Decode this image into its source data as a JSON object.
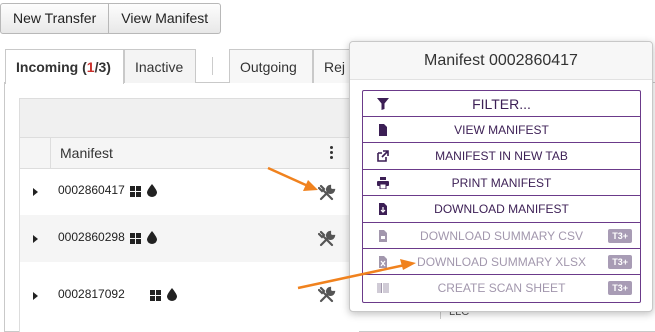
{
  "toolbar": {
    "new_transfer": "New Transfer",
    "view_manifest": "View Manifest"
  },
  "tabs": {
    "incoming_label": "Incoming",
    "incoming_open": " (",
    "incoming_current": "1",
    "incoming_total": "/3)",
    "inactive": "Inactive",
    "outgoing": "Outgoing",
    "rejected_partial": "Rej"
  },
  "grid": {
    "column_header": "Manifest",
    "rows": [
      {
        "manifest": "0002860417"
      },
      {
        "manifest": "0002860298"
      },
      {
        "manifest": "0002817092"
      }
    ],
    "partial_cell": "LLC"
  },
  "popover": {
    "title": "Manifest 0002860417",
    "filter": "FILTER...",
    "items": [
      {
        "label": "VIEW MANIFEST",
        "icon": "file-icon"
      },
      {
        "label": "MANIFEST IN NEW TAB",
        "icon": "external-link-icon"
      },
      {
        "label": "PRINT MANIFEST",
        "icon": "print-icon"
      },
      {
        "label": "DOWNLOAD MANIFEST",
        "icon": "download-file-icon"
      },
      {
        "label": "DOWNLOAD SUMMARY CSV",
        "icon": "csv-file-icon",
        "badge": "T3+"
      },
      {
        "label": "DOWNLOAD SUMMARY XLSX",
        "icon": "excel-file-icon",
        "badge": "T3+"
      },
      {
        "label": "CREATE SCAN SHEET",
        "icon": "barcode-icon",
        "badge": "T3+"
      }
    ]
  },
  "colors": {
    "menu_accent": "#6b3a8a",
    "arrow": "#f0821e",
    "badge": "#a89cb5",
    "incoming_count_red": "#c9302c"
  }
}
